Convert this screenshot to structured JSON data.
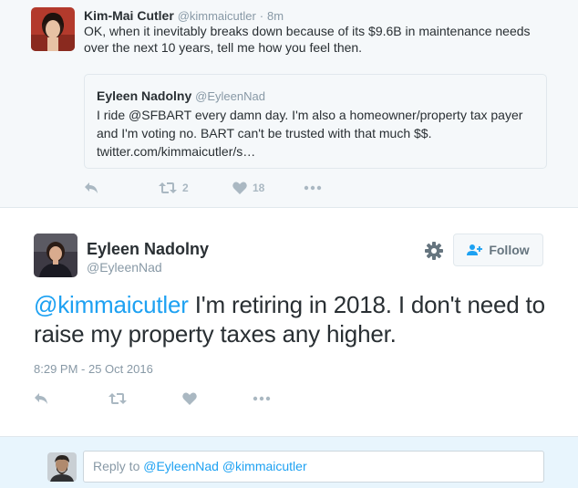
{
  "parent_tweet": {
    "author_name": "Kim-Mai Cutler",
    "author_handle": "@kimmaicutler",
    "separator": "·",
    "time": "8m",
    "text": "OK, when it inevitably breaks down because of its $9.6B in maintenance needs over the next 10 years, tell me how you feel then.",
    "quote": {
      "author_name": "Eyleen Nadolny",
      "author_handle": "@EyleenNad",
      "text": "I ride @SFBART every damn day. I'm also a homeowner/property tax payer and I'm voting no. BART can't be trusted with that much $$. twitter.com/kimmaicutler/s…"
    },
    "actions": {
      "retweet_count": "2",
      "like_count": "18"
    }
  },
  "main_tweet": {
    "author_name": "Eyleen Nadolny",
    "author_handle": "@EyleenNad",
    "follow_label": "Follow",
    "mention": "@kimmaicutler",
    "text": " I'm retiring in 2018. I don't need to raise my property taxes any higher.",
    "timestamp": "8:29 PM - 25 Oct 2016"
  },
  "reply": {
    "prefix": "Reply to ",
    "mentions": "@EyleenNad @kimmaicutler"
  },
  "icons": {
    "reply": "reply-icon",
    "retweet": "retweet-icon",
    "like": "heart-icon",
    "more": "more-icon",
    "settings": "gear-icon",
    "follow": "add-user-icon"
  },
  "colors": {
    "accent": "#1da1f2",
    "muted": "#8899a6",
    "icon_gray": "#aab8c2",
    "parent_bg": "#f5f8fa",
    "reply_bg": "#e8f5fd"
  }
}
